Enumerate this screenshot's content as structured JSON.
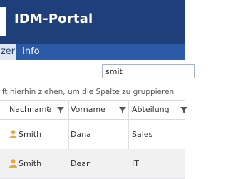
{
  "header": {
    "title": "IDM-Portal"
  },
  "tabs": [
    {
      "label": "zer",
      "active": true
    },
    {
      "label": "Info",
      "active": false
    }
  ],
  "search": {
    "value": "smit"
  },
  "group_hint": "ift hierhin ziehen, um die Spalte zu gruppieren",
  "columns": [
    {
      "label": "Nachname",
      "sort": "ascending"
    },
    {
      "label": "Vorname"
    },
    {
      "label": "Abteilung"
    }
  ],
  "rows": [
    {
      "nachname": "Smith",
      "vorname": "Dana",
      "abteilung": "Sales"
    },
    {
      "nachname": "Smith",
      "vorname": "Dean",
      "abteilung": "IT"
    }
  ],
  "icons": {
    "user": "user-icon",
    "filter": "filter-icon",
    "sort": "sort-ascending-icon"
  },
  "colors": {
    "header_bg": "#1e3f7a",
    "tabbar_bg": "#2b5aa8",
    "user_icon": "#f0a830"
  }
}
